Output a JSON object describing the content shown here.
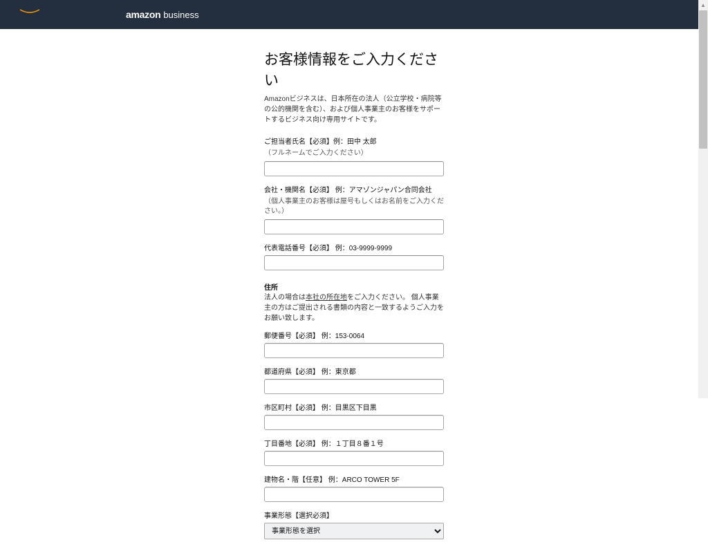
{
  "header": {
    "logo_main": "amazon",
    "logo_sub": "business"
  },
  "page": {
    "title": "お客様情報をご入力ください",
    "intro": "Amazonビジネスは、日本所在の法人（公立学校・病院等の公的機関を含む）、および個人事業主のお客様をサポートするビジネス向け専用サイトです。"
  },
  "fields": {
    "name": {
      "label": "ご担当者氏名【必須】例：田中 太郎",
      "sublabel": "（フルネームでご入力ください）"
    },
    "company": {
      "label": "会社・機関名【必須】 例：アマゾンジャパン合同会社",
      "sublabel": "（個人事業主のお客様は屋号もしくはお名前をご入力ください。）"
    },
    "phone": {
      "label": "代表電話番号【必須】 例：03-9999-9999"
    },
    "address_section": {
      "title": "住所",
      "text_prefix": "法人の場合は",
      "text_underline": "本社の所在地",
      "text_suffix": "をご入力ください。 個人事業主の方はご提出される書類の内容と一致するようご入力をお願い致します。"
    },
    "postal": {
      "label": "郵便番号【必須】 例：153-0064"
    },
    "prefecture": {
      "label": "都道府県【必須】 例：東京都"
    },
    "city": {
      "label": "市区町村【必須】 例：目黒区下目黒"
    },
    "street": {
      "label": "丁目番地【必須】 例：１丁目８番１号"
    },
    "building": {
      "label": "建物名・階【任意】 例：ARCO TOWER 5F"
    },
    "business_type": {
      "label": "事業形態【選択必須】",
      "selected": "事業形態を選択"
    }
  }
}
